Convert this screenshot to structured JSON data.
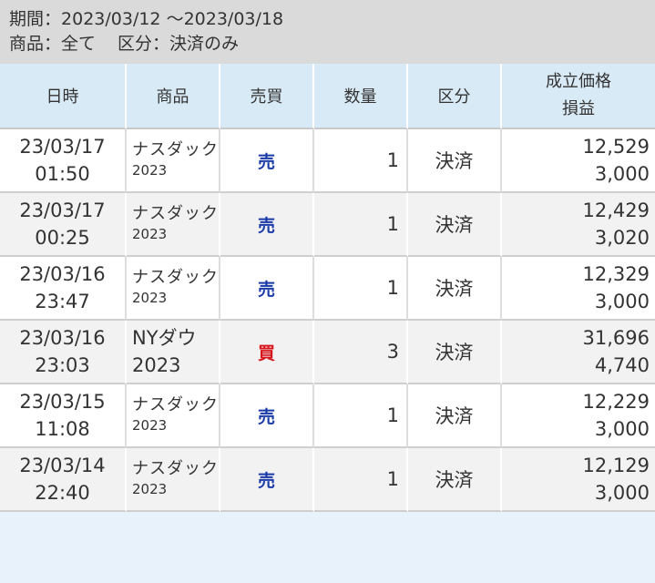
{
  "filter": {
    "period_label": "期間：",
    "period_value": "2023/03/12 〜2023/03/18",
    "product_label": "商品：",
    "product_value": "全て",
    "type_label": "区分：",
    "type_value": "決済のみ"
  },
  "headers": {
    "datetime": "日時",
    "product": "商品",
    "side": "売買",
    "quantity": "数量",
    "type": "区分",
    "price": "成立価格",
    "pnl": "損益"
  },
  "rows": [
    {
      "date": "23/03/17",
      "time": "01:50",
      "product": "ナスダック",
      "product_sub": "2023",
      "side": "売",
      "side_kind": "sell",
      "qty": "1",
      "type": "決済",
      "price": "12,529",
      "pnl": "3,000"
    },
    {
      "date": "23/03/17",
      "time": "00:25",
      "product": "ナスダック",
      "product_sub": "2023",
      "side": "売",
      "side_kind": "sell",
      "qty": "1",
      "type": "決済",
      "price": "12,429",
      "pnl": "3,020"
    },
    {
      "date": "23/03/16",
      "time": "23:47",
      "product": "ナスダック",
      "product_sub": "2023",
      "side": "売",
      "side_kind": "sell",
      "qty": "1",
      "type": "決済",
      "price": "12,329",
      "pnl": "3,000"
    },
    {
      "date": "23/03/16",
      "time": "23:03",
      "product": "NYダウ",
      "product_sub": "2023",
      "side": "買",
      "side_kind": "buy",
      "qty": "3",
      "type": "決済",
      "price": "31,696",
      "pnl": "4,740"
    },
    {
      "date": "23/03/15",
      "time": "11:08",
      "product": "ナスダック",
      "product_sub": "2023",
      "side": "売",
      "side_kind": "sell",
      "qty": "1",
      "type": "決済",
      "price": "12,229",
      "pnl": "3,000"
    },
    {
      "date": "23/03/14",
      "time": "22:40",
      "product": "ナスダック",
      "product_sub": "2023",
      "side": "売",
      "side_kind": "sell",
      "qty": "1",
      "type": "決済",
      "price": "12,129",
      "pnl": "3,000"
    }
  ],
  "colors": {
    "sell": "#1a3aa8",
    "buy": "#d7141a",
    "header_bg": "#d8eaf6",
    "filter_bg": "#dadada"
  }
}
